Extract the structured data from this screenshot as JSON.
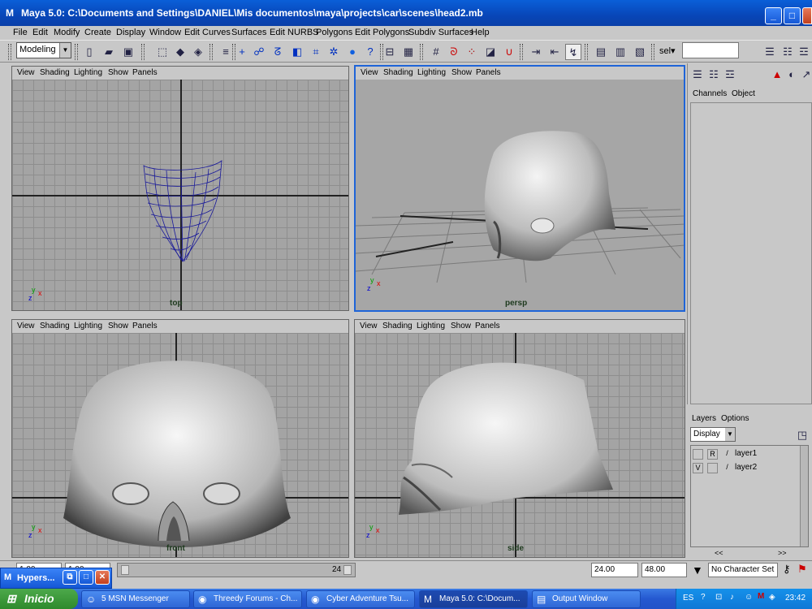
{
  "window": {
    "title": "Maya 5.0: C:\\Documents and Settings\\DANIEL\\Mis documentos\\maya\\projects\\car\\scenes\\head2.mb",
    "minimize": "_",
    "maximize": "□",
    "close": "✕"
  },
  "menubar": [
    "File",
    "Edit",
    "Modify",
    "Create",
    "Display",
    "Window",
    "Edit Curves",
    "Surfaces",
    "Edit NURBS",
    "Polygons",
    "Edit Polygons",
    "Subdiv Surfaces",
    "Help"
  ],
  "toolbar": {
    "mode": "Modeling",
    "sel_label": "sel▾",
    "sel_value": ""
  },
  "panel_menu": [
    "View",
    "Shading",
    "Lighting",
    "Show",
    "Panels"
  ],
  "viewports": {
    "top": "top",
    "persp": "persp",
    "front": "front",
    "side": "side"
  },
  "channel_box": {
    "channels": "Channels",
    "object": "Object"
  },
  "layers": {
    "menu_layers": "Layers",
    "menu_options": "Options",
    "display": "Display",
    "rows": [
      {
        "v": "",
        "r": "R",
        "name": "layer1"
      },
      {
        "v": "V",
        "r": "",
        "name": "layer2"
      }
    ]
  },
  "timeline": {
    "left_a": "1.00",
    "left_b": "1.00",
    "current": "24",
    "end_a": "24.00",
    "end_b": "48.00",
    "char_set": "No Character Set",
    "scroll_left": "<<",
    "scroll_right": ">>"
  },
  "hypershade": {
    "title": "Hypers..."
  },
  "taskbar": {
    "start": "Inicio",
    "tasks": [
      {
        "label": "5 MSN Messenger",
        "active": false
      },
      {
        "label": "Threedy Forums - Ch...",
        "active": false
      },
      {
        "label": "Cyber Adventure Tsu...",
        "active": false
      },
      {
        "label": "Maya 5.0: C:\\Docum...",
        "active": true
      },
      {
        "label": "Output Window",
        "active": false
      }
    ],
    "lang": "ES",
    "clock": "23:42"
  }
}
